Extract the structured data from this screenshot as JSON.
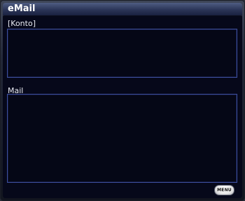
{
  "window": {
    "title": "eMail"
  },
  "konto": {
    "label": "[Konto]",
    "value": ""
  },
  "mail": {
    "label": "Mail",
    "value": ""
  },
  "footer": {
    "menu_label": "MENU"
  }
}
